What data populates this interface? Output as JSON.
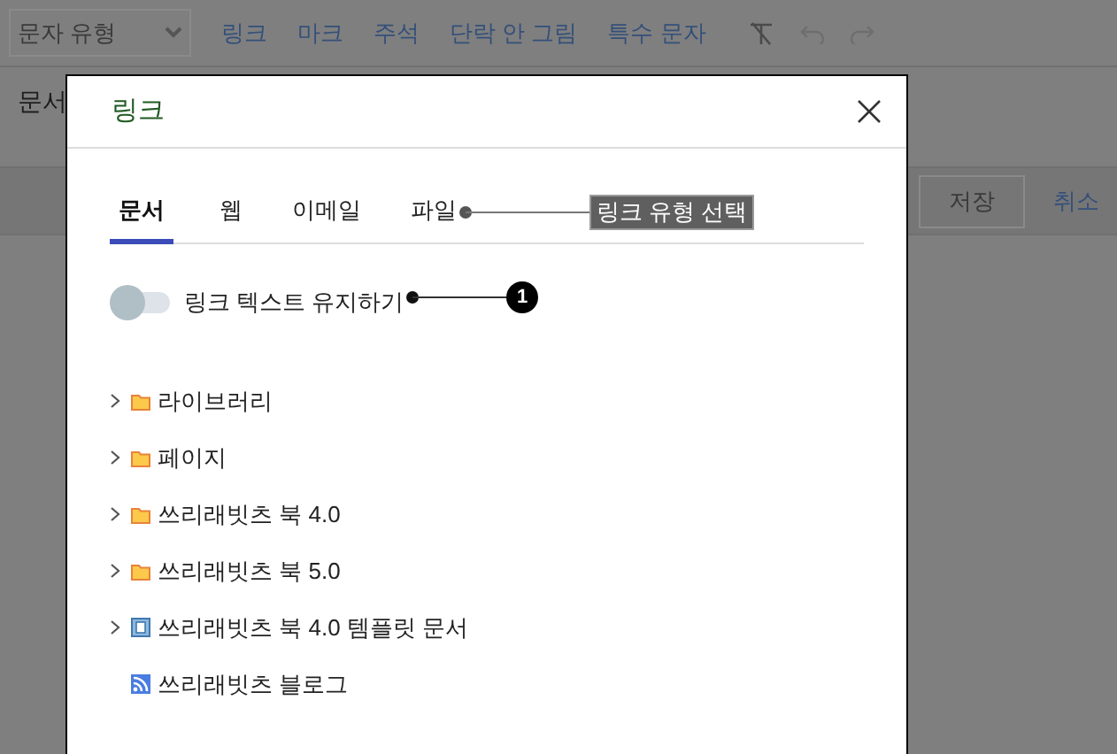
{
  "toolbar": {
    "format_select": "문자 유형",
    "items": [
      "링크",
      "마크",
      "주석",
      "단락 안 그림",
      "특수 문자"
    ]
  },
  "editor": {
    "label": "문서"
  },
  "actions": {
    "save": "저장",
    "cancel": "취소"
  },
  "dialog": {
    "title": "링크",
    "tabs": [
      {
        "label": "문서",
        "selected": true
      },
      {
        "label": "웹",
        "selected": false
      },
      {
        "label": "이메일",
        "selected": false
      },
      {
        "label": "파일",
        "selected": false
      }
    ],
    "keep_text_toggle": {
      "label": "링크 텍스트 유지하기",
      "on": false
    },
    "tree": [
      {
        "label": "라이브러리",
        "kind": "folder",
        "expandable": true
      },
      {
        "label": "페이지",
        "kind": "folder",
        "expandable": true
      },
      {
        "label": "쓰리래빗츠 북 4.0",
        "kind": "folder",
        "expandable": true
      },
      {
        "label": "쓰리래빗츠 북 5.0",
        "kind": "folder",
        "expandable": true
      },
      {
        "label": "쓰리래빗츠 북 4.0 템플릿 문서",
        "kind": "document",
        "expandable": true
      },
      {
        "label": "쓰리래빗츠 블로그",
        "kind": "feed",
        "expandable": false
      }
    ]
  },
  "annotations": [
    {
      "kind": "label",
      "text": "링크 유형 선택"
    },
    {
      "kind": "number",
      "text": "1"
    }
  ]
}
